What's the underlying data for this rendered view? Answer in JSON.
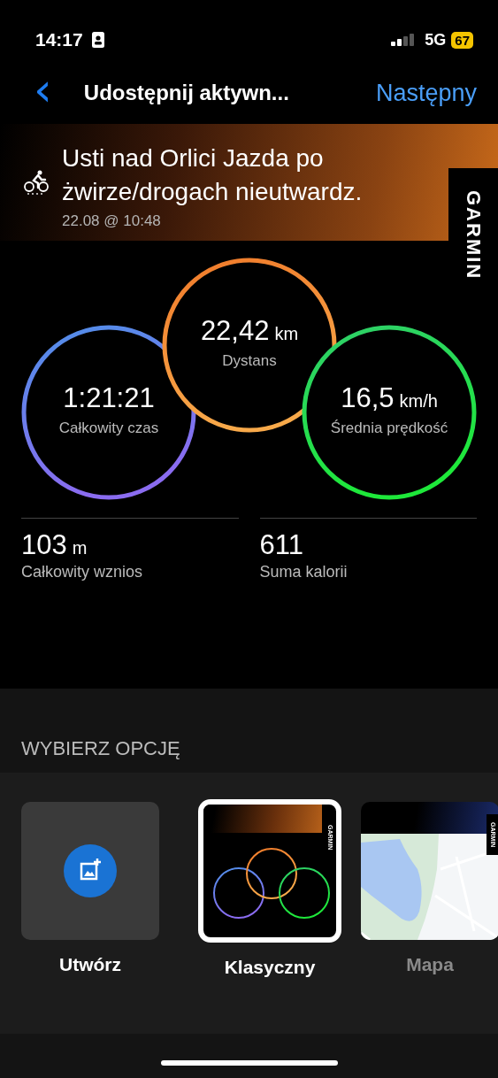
{
  "status_bar": {
    "time": "14:17",
    "network": "5G",
    "battery": "67"
  },
  "nav": {
    "back": "‹",
    "title": "Udostępnij aktywn...",
    "action": "Następny"
  },
  "activity": {
    "title": "Usti nad Orlici Jazda po żwirze/drogach nieutwardz.",
    "date": "22.08 @ 10:48",
    "brand": "GARMIN"
  },
  "rings": [
    {
      "kind": "left",
      "value": "1:21:21",
      "label": "Całkowity czas",
      "color": "#4f8fe8"
    },
    {
      "kind": "center",
      "value": "22,42",
      "unit": "km",
      "label": "Dystans",
      "color": "#f07a2a"
    },
    {
      "kind": "right",
      "value": "16,5",
      "unit": "km/h",
      "label": "Średnia prędkość",
      "color": "#2fcf6a"
    }
  ],
  "stats": [
    {
      "value": "103",
      "unit": "m",
      "label": "Całkowity wznios"
    },
    {
      "value": "611",
      "label": "Suma kalorii"
    }
  ],
  "section_title": "WYBIERZ OPCJĘ",
  "options": [
    {
      "kind": "create",
      "label": "Utwórz",
      "selected": false,
      "disabled": false
    },
    {
      "kind": "classic",
      "label": "Klasyczny",
      "selected": true,
      "disabled": false,
      "badge": "GARMIN"
    },
    {
      "kind": "map",
      "label": "Mapa",
      "selected": false,
      "disabled": true,
      "badge": "GARMIN"
    }
  ]
}
